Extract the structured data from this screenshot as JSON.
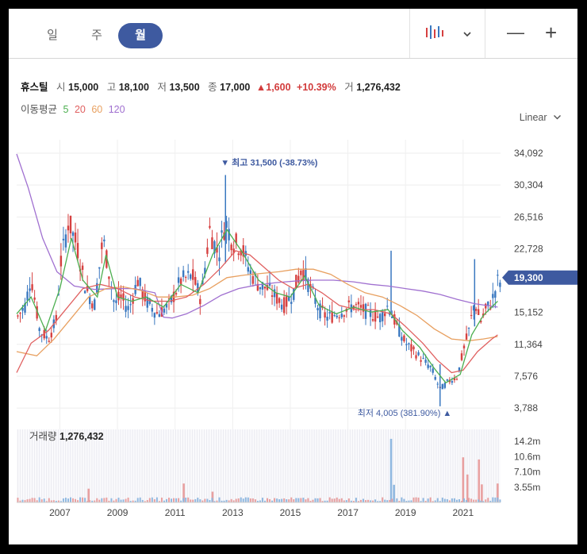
{
  "tabs": [
    {
      "label": "일",
      "active": false
    },
    {
      "label": "주",
      "active": false
    },
    {
      "label": "월",
      "active": true
    }
  ],
  "toolbar": {
    "chart_type_icon": "candlestick-icon",
    "dropdown_icon": "chevron-down-icon",
    "zoom_out": "—",
    "zoom_in": "+"
  },
  "info": {
    "name": "휴스틸",
    "open_label": "시",
    "open": "15,000",
    "high_label": "고",
    "high": "18,100",
    "low_label": "저",
    "low": "13,500",
    "close_label": "종",
    "close": "17,000",
    "change": "▲1,600",
    "change_pct": "+10.39%",
    "volume_label": "거",
    "volume": "1,276,432"
  },
  "ma_legend": {
    "label": "이동평균",
    "items": [
      {
        "text": "5",
        "color": "#4caf50"
      },
      {
        "text": "20",
        "color": "#e06060"
      },
      {
        "text": "60",
        "color": "#e8a060"
      },
      {
        "text": "120",
        "color": "#a070d0"
      }
    ]
  },
  "scale_label": "Linear",
  "chart_data": {
    "type": "candlestick",
    "price_axis_ticks": [
      "34,092",
      "30,304",
      "26,516",
      "22,728",
      "19,300",
      "15,152",
      "11,364",
      "7,576",
      "3,788"
    ],
    "price_axis_values": [
      34092,
      30304,
      26516,
      22728,
      15152,
      11364,
      7576,
      3788
    ],
    "current_price_label": "19,300",
    "current_price": 19300,
    "ylim": [
      2200,
      35700
    ],
    "x_ticks": [
      "2007",
      "2009",
      "2011",
      "2013",
      "2015",
      "2017",
      "2019",
      "2021"
    ],
    "xlim": [
      2005.5,
      2022.3
    ],
    "up_color": "#d64040",
    "down_color": "#3a78c0",
    "high_marker": {
      "label": "▼ 최고",
      "value_text": "31,500 (-38.73%)",
      "value": 31500,
      "t": 2012.75
    },
    "low_marker": {
      "label": "최저",
      "value_text": "4,005 (381.90%) ▲",
      "value": 4005,
      "t": 2020.2
    },
    "price_path": [
      [
        2005.5,
        14500
      ],
      [
        2005.8,
        16000
      ],
      [
        2006.0,
        19500
      ],
      [
        2006.3,
        13000
      ],
      [
        2006.6,
        12000
      ],
      [
        2006.9,
        14500
      ],
      [
        2007.0,
        20500
      ],
      [
        2007.3,
        26000
      ],
      [
        2007.6,
        23000
      ],
      [
        2007.9,
        18000
      ],
      [
        2008.2,
        16000
      ],
      [
        2008.5,
        24000
      ],
      [
        2008.7,
        20000
      ],
      [
        2008.9,
        16000
      ],
      [
        2009.1,
        17000
      ],
      [
        2009.4,
        15500
      ],
      [
        2009.7,
        19000
      ],
      [
        2010.0,
        16500
      ],
      [
        2010.4,
        15000
      ],
      [
        2010.8,
        16000
      ],
      [
        2011.2,
        19000
      ],
      [
        2011.6,
        19500
      ],
      [
        2011.9,
        16800
      ],
      [
        2012.2,
        25000
      ],
      [
        2012.5,
        22000
      ],
      [
        2012.75,
        26000
      ],
      [
        2013.0,
        23500
      ],
      [
        2013.3,
        23000
      ],
      [
        2013.6,
        20000
      ],
      [
        2013.9,
        18500
      ],
      [
        2014.2,
        18000
      ],
      [
        2014.5,
        17000
      ],
      [
        2014.8,
        16000
      ],
      [
        2015.1,
        17500
      ],
      [
        2015.4,
        20500
      ],
      [
        2015.7,
        18000
      ],
      [
        2016.0,
        15500
      ],
      [
        2016.3,
        14500
      ],
      [
        2016.6,
        15000
      ],
      [
        2016.9,
        15500
      ],
      [
        2017.2,
        16000
      ],
      [
        2017.5,
        15500
      ],
      [
        2017.8,
        15000
      ],
      [
        2018.1,
        14500
      ],
      [
        2018.4,
        16000
      ],
      [
        2018.7,
        13500
      ],
      [
        2019.0,
        11500
      ],
      [
        2019.3,
        10500
      ],
      [
        2019.6,
        9500
      ],
      [
        2019.9,
        8500
      ],
      [
        2020.2,
        6000
      ],
      [
        2020.5,
        7000
      ],
      [
        2020.8,
        7500
      ],
      [
        2021.0,
        10500
      ],
      [
        2021.2,
        13000
      ],
      [
        2021.4,
        16500
      ],
      [
        2021.6,
        14000
      ],
      [
        2021.8,
        15500
      ],
      [
        2022.0,
        16500
      ],
      [
        2022.2,
        18800
      ]
    ],
    "ma_5": [
      [
        2005.5,
        15000
      ],
      [
        2006.0,
        17000
      ],
      [
        2006.5,
        13000
      ],
      [
        2007.0,
        18000
      ],
      [
        2007.4,
        24000
      ],
      [
        2007.8,
        19000
      ],
      [
        2008.3,
        17000
      ],
      [
        2008.6,
        22000
      ],
      [
        2009.0,
        17000
      ],
      [
        2009.5,
        16500
      ],
      [
        2010.0,
        17000
      ],
      [
        2010.6,
        15800
      ],
      [
        2011.2,
        18500
      ],
      [
        2011.8,
        17500
      ],
      [
        2012.3,
        22000
      ],
      [
        2012.8,
        25000
      ],
      [
        2013.3,
        22500
      ],
      [
        2013.9,
        19000
      ],
      [
        2014.5,
        17500
      ],
      [
        2015.0,
        17000
      ],
      [
        2015.5,
        19500
      ],
      [
        2016.0,
        16000
      ],
      [
        2016.6,
        15000
      ],
      [
        2017.2,
        15800
      ],
      [
        2017.8,
        15200
      ],
      [
        2018.4,
        15500
      ],
      [
        2018.9,
        13000
      ],
      [
        2019.5,
        11000
      ],
      [
        2020.0,
        8500
      ],
      [
        2020.4,
        6800
      ],
      [
        2020.9,
        7800
      ],
      [
        2021.3,
        12500
      ],
      [
        2021.7,
        14800
      ],
      [
        2022.2,
        16500
      ]
    ],
    "ma_20": [
      [
        2005.5,
        8000
      ],
      [
        2006.0,
        11500
      ],
      [
        2006.6,
        13000
      ],
      [
        2007.2,
        15500
      ],
      [
        2007.8,
        18000
      ],
      [
        2008.4,
        18500
      ],
      [
        2009.0,
        18000
      ],
      [
        2009.6,
        17000
      ],
      [
        2010.2,
        16500
      ],
      [
        2010.8,
        16500
      ],
      [
        2011.4,
        17000
      ],
      [
        2012.0,
        18500
      ],
      [
        2012.6,
        20500
      ],
      [
        2013.1,
        22500
      ],
      [
        2013.6,
        22000
      ],
      [
        2014.1,
        20500
      ],
      [
        2014.6,
        19000
      ],
      [
        2015.1,
        18000
      ],
      [
        2015.6,
        18500
      ],
      [
        2016.1,
        17500
      ],
      [
        2016.7,
        16000
      ],
      [
        2017.3,
        15500
      ],
      [
        2017.9,
        15500
      ],
      [
        2018.5,
        15000
      ],
      [
        2019.0,
        13500
      ],
      [
        2019.6,
        11500
      ],
      [
        2020.1,
        9500
      ],
      [
        2020.6,
        8000
      ],
      [
        2021.0,
        8300
      ],
      [
        2021.5,
        10500
      ],
      [
        2022.0,
        12000
      ],
      [
        2022.2,
        12500
      ]
    ],
    "ma_60": [
      [
        2005.5,
        10500
      ],
      [
        2006.2,
        10000
      ],
      [
        2006.8,
        12000
      ],
      [
        2007.4,
        14500
      ],
      [
        2008.0,
        17000
      ],
      [
        2008.6,
        18000
      ],
      [
        2009.2,
        18200
      ],
      [
        2009.8,
        17800
      ],
      [
        2010.4,
        17000
      ],
      [
        2011.0,
        17000
      ],
      [
        2011.6,
        17200
      ],
      [
        2012.2,
        18000
      ],
      [
        2012.8,
        19300
      ],
      [
        2013.4,
        19600
      ],
      [
        2014.0,
        19800
      ],
      [
        2014.6,
        20000
      ],
      [
        2015.2,
        20300
      ],
      [
        2015.8,
        20300
      ],
      [
        2016.4,
        19700
      ],
      [
        2017.0,
        18500
      ],
      [
        2017.6,
        17500
      ],
      [
        2018.2,
        17000
      ],
      [
        2018.8,
        16000
      ],
      [
        2019.4,
        14800
      ],
      [
        2020.0,
        13200
      ],
      [
        2020.6,
        12000
      ],
      [
        2021.2,
        11800
      ],
      [
        2021.7,
        12000
      ],
      [
        2022.2,
        12300
      ]
    ],
    "ma_120": [
      [
        2005.5,
        34000
      ],
      [
        2005.9,
        30000
      ],
      [
        2006.4,
        24000
      ],
      [
        2006.9,
        20000
      ],
      [
        2007.5,
        18300
      ],
      [
        2008.2,
        17900
      ],
      [
        2009.0,
        18000
      ],
      [
        2009.6,
        18000
      ],
      [
        2010.0,
        17700
      ],
      [
        2010.3,
        17500
      ],
      [
        2010.6,
        14600
      ],
      [
        2010.9,
        14500
      ],
      [
        2011.4,
        15000
      ],
      [
        2012.0,
        16000
      ],
      [
        2012.6,
        17200
      ],
      [
        2013.2,
        18000
      ],
      [
        2013.8,
        18400
      ],
      [
        2014.5,
        18700
      ],
      [
        2015.2,
        18900
      ],
      [
        2015.8,
        19000
      ],
      [
        2016.5,
        19000
      ],
      [
        2017.2,
        18800
      ],
      [
        2017.8,
        18500
      ],
      [
        2018.4,
        18300
      ],
      [
        2019.0,
        18000
      ],
      [
        2019.6,
        17700
      ],
      [
        2020.2,
        17300
      ],
      [
        2020.8,
        16700
      ],
      [
        2021.4,
        16200
      ],
      [
        2022.2,
        15800
      ]
    ],
    "volume_axis_ticks": [
      "14.2m",
      "10.6m",
      "7.10m",
      "3.55m"
    ],
    "volume_axis_values": [
      14200000,
      10600000,
      7100000,
      3550000
    ],
    "volume_ylim": [
      0,
      17000000
    ],
    "volume_label": "거래량",
    "volume_value": "1,276,432",
    "volume_spikes": [
      {
        "t": 2008.0,
        "v": 3200000,
        "up": true
      },
      {
        "t": 2011.3,
        "v": 4400000,
        "up": true
      },
      {
        "t": 2012.3,
        "v": 2500000,
        "up": true
      },
      {
        "t": 2018.5,
        "v": 14800000,
        "up": false
      },
      {
        "t": 2018.6,
        "v": 4100000,
        "up": false
      },
      {
        "t": 2021.0,
        "v": 10500000,
        "up": true
      },
      {
        "t": 2021.15,
        "v": 6500000,
        "up": true
      },
      {
        "t": 2021.55,
        "v": 10000000,
        "up": true
      },
      {
        "t": 2021.65,
        "v": 4200000,
        "up": true
      },
      {
        "t": 2022.2,
        "v": 4400000,
        "up": true
      }
    ]
  }
}
